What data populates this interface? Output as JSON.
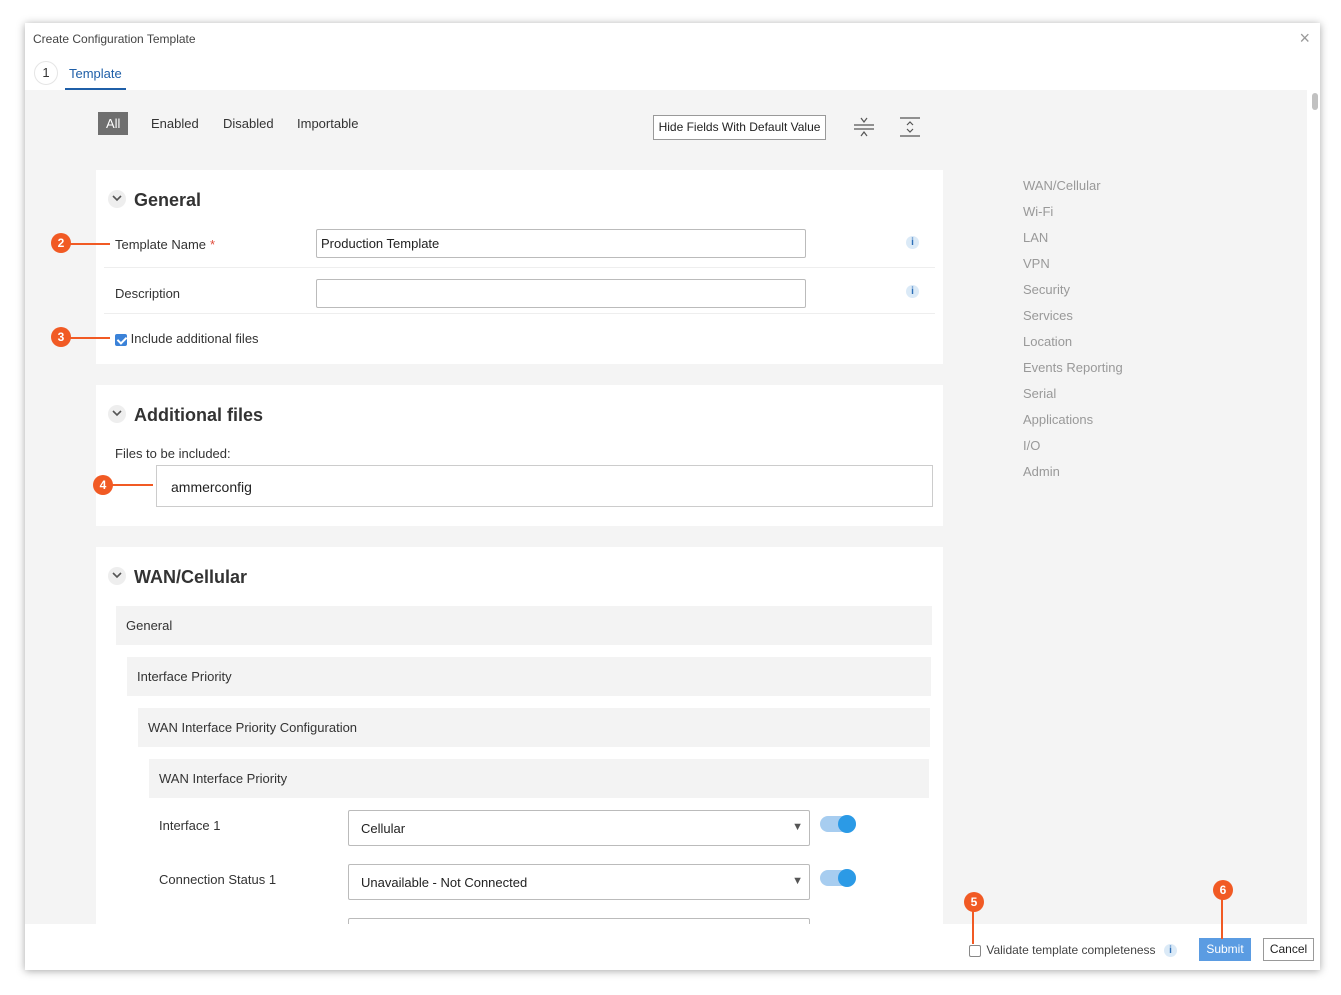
{
  "dialog": {
    "title": "Create Configuration Template"
  },
  "steps": [
    {
      "number": "1",
      "label": "Template"
    }
  ],
  "filters": [
    "All",
    "Enabled",
    "Disabled",
    "Importable"
  ],
  "toolbar": {
    "hide_default_label": "Hide Fields With Default Value"
  },
  "general": {
    "title": "General",
    "template_name_label": "Template Name",
    "required_marker": "*",
    "template_name_value": "Production Template",
    "description_label": "Description",
    "description_value": "",
    "include_files_label": "Include additional files",
    "include_files_checked": true
  },
  "additional_files": {
    "title": "Additional files",
    "files_label": "Files to be included:",
    "files_value": "ammerconfig"
  },
  "wan": {
    "title": "WAN/Cellular",
    "general_label": "General",
    "interface_priority_label": "Interface Priority",
    "wan_config_label": "WAN Interface Priority Configuration",
    "wan_priority_label": "WAN Interface Priority",
    "interface1_label": "Interface 1",
    "interface1_value": "Cellular",
    "connection_status1_label": "Connection Status 1",
    "connection_status1_value": "Unavailable - Not Connected"
  },
  "right_nav": [
    "WAN/Cellular",
    "Wi-Fi",
    "LAN",
    "VPN",
    "Security",
    "Services",
    "Location",
    "Events Reporting",
    "Serial",
    "Applications",
    "I/O",
    "Admin"
  ],
  "footer": {
    "validate_label": "Validate template completeness",
    "submit_label": "Submit",
    "cancel_label": "Cancel"
  },
  "callouts": [
    "2",
    "3",
    "4",
    "5",
    "6"
  ],
  "colors": {
    "accent": "#1f5fa8",
    "callout": "#f15a24",
    "submit": "#5b9ce2"
  }
}
